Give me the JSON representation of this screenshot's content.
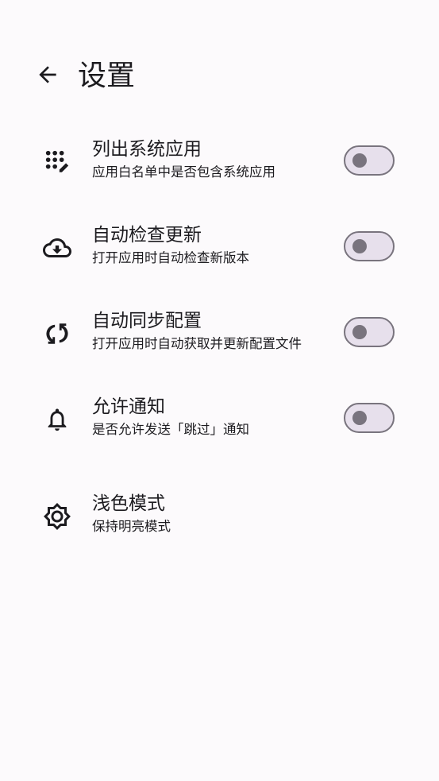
{
  "header": {
    "back_icon": "arrow-left-icon",
    "title": "设置"
  },
  "settings": [
    {
      "id": "list-system-apps",
      "icon": "apps-edit-icon",
      "title": "列出系统应用",
      "subtitle": "应用白名单中是否包含系统应用",
      "has_toggle": true,
      "toggle_on": false
    },
    {
      "id": "auto-check-updates",
      "icon": "cloud-download-icon",
      "title": "自动检查更新",
      "subtitle": "打开应用时自动检查新版本",
      "has_toggle": true,
      "toggle_on": false
    },
    {
      "id": "auto-sync-config",
      "icon": "sync-icon",
      "title": "自动同步配置",
      "subtitle": "打开应用时自动获取并更新配置文件",
      "has_toggle": true,
      "toggle_on": false
    },
    {
      "id": "allow-notifications",
      "icon": "bell-icon",
      "title": "允许通知",
      "subtitle": "是否允许发送「跳过」通知",
      "has_toggle": true,
      "toggle_on": false
    },
    {
      "id": "light-mode",
      "icon": "brightness-icon",
      "title": "浅色模式",
      "subtitle": "保持明亮模式",
      "has_toggle": false
    }
  ],
  "colors": {
    "background": "#fcfafc",
    "text": "#1c1b1f",
    "toggle_track": "#e7e0ec",
    "toggle_outline": "#79747e"
  }
}
